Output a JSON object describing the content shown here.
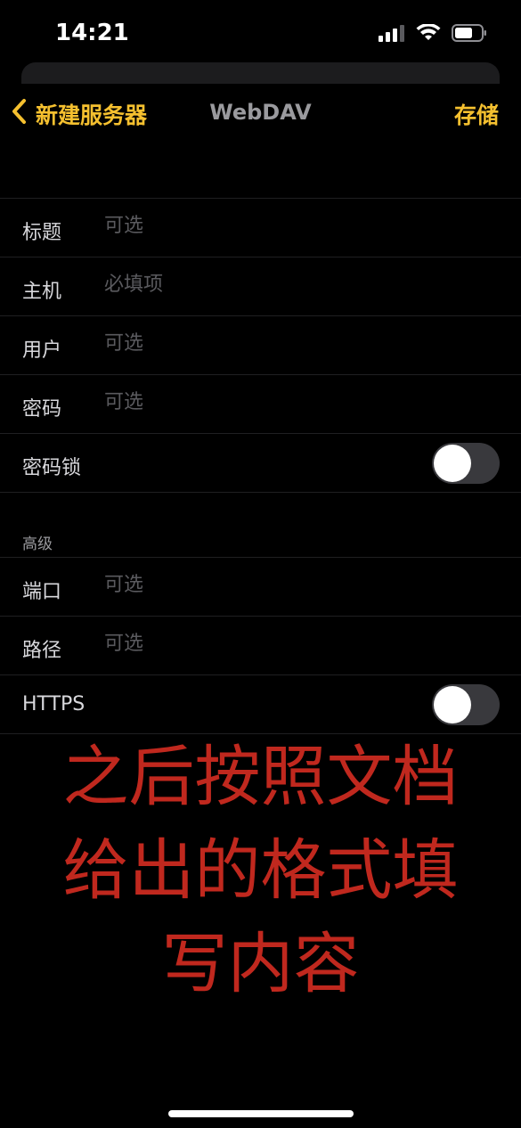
{
  "status_bar": {
    "time": "14:21"
  },
  "nav": {
    "back_label": "新建服务器",
    "title": "WebDAV",
    "save_label": "存储"
  },
  "fields": [
    {
      "label": "标题",
      "placeholder": "可选",
      "value": ""
    },
    {
      "label": "主机",
      "placeholder": "必填项",
      "value": ""
    },
    {
      "label": "用户",
      "placeholder": "可选",
      "value": ""
    },
    {
      "label": "密码",
      "placeholder": "可选",
      "value": ""
    }
  ],
  "password_lock": {
    "label": "密码锁",
    "enabled": false
  },
  "advanced": {
    "header": "高级",
    "fields": [
      {
        "label": "端口",
        "placeholder": "可选",
        "value": ""
      },
      {
        "label": "路径",
        "placeholder": "可选",
        "value": ""
      }
    ],
    "https": {
      "label": "HTTPS",
      "enabled": false
    }
  },
  "overlay": {
    "lines": [
      "之后按照文档",
      "给出的格式填",
      "写内容"
    ]
  },
  "colors": {
    "accent": "#f5c02f",
    "overlay": "#c0281e",
    "background": "#000000"
  },
  "icons": {
    "back": "chevron-left-icon",
    "signal": "cellular-signal-icon",
    "wifi": "wifi-icon",
    "battery": "battery-icon"
  }
}
